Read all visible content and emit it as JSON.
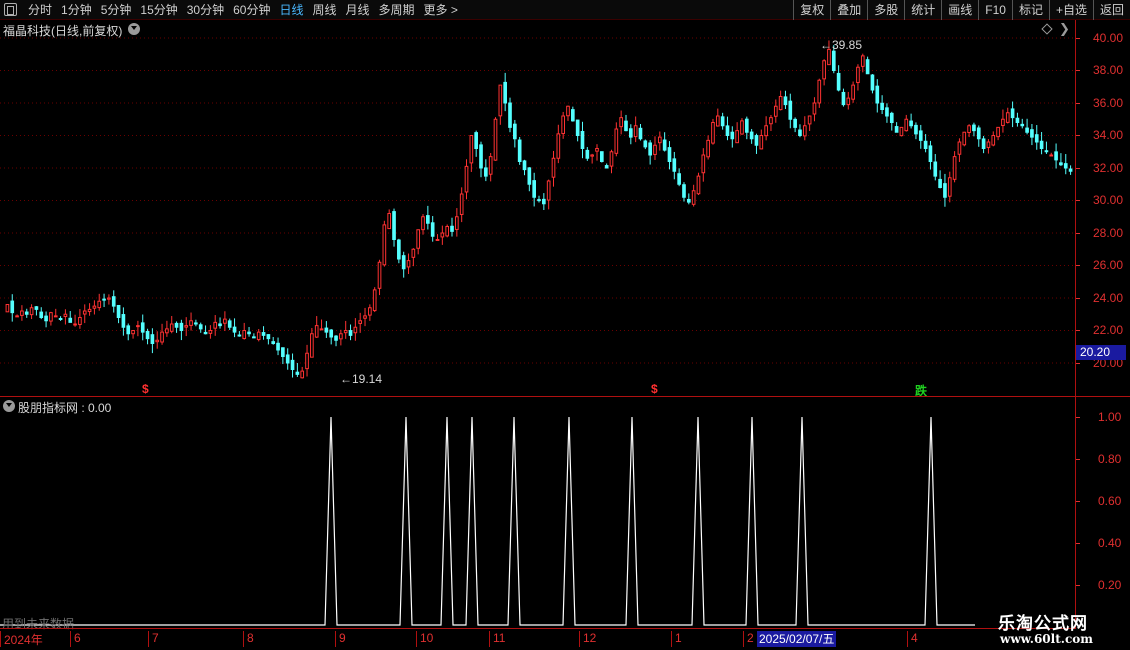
{
  "toolbar": {
    "period_tabs": [
      "分时",
      "1分钟",
      "5分钟",
      "15分钟",
      "30分钟",
      "60分钟",
      "日线",
      "周线",
      "月线",
      "多周期",
      "更多 >"
    ],
    "active_tab": "日线",
    "buttons": [
      "复权",
      "叠加",
      "多股",
      "统计",
      "画线",
      "F10",
      "标记",
      "+自选",
      "返回"
    ]
  },
  "price_pane": {
    "title": "福晶科技(日线,前复权)",
    "y_ticks": [
      "40.00",
      "38.00",
      "36.00",
      "34.00",
      "32.00",
      "30.00",
      "28.00",
      "26.00",
      "24.00",
      "22.00",
      "20.00"
    ],
    "last_price_label": "20.20",
    "high_label": "39.85",
    "low_label": "19.14",
    "signals": [
      {
        "text": "$",
        "kind": "buy"
      },
      {
        "text": "$",
        "kind": "buy"
      },
      {
        "text": "跌",
        "kind": "sell"
      }
    ]
  },
  "indicator_pane": {
    "title": "股朋指标网 : 0.00",
    "y_ticks": [
      "1.00",
      "0.80",
      "0.60",
      "0.40",
      "0.20"
    ],
    "note": "用到未来数据"
  },
  "date_axis": {
    "labels": [
      "2024年",
      "6",
      "7",
      "8",
      "9",
      "10",
      "11",
      "12",
      "1",
      "2",
      "4"
    ],
    "cursor_date": "2025/02/07/五"
  },
  "watermark": {
    "title": "乐淘公式网",
    "url": "www.60lt.com"
  },
  "chart_data": {
    "type": "candlestick",
    "title": "福晶科技(日线,前复权)",
    "price_ylim": [
      19,
      40.5
    ],
    "high": 39.85,
    "low": 19.14,
    "last": 20.2,
    "closes": [
      23.6,
      23.1,
      22.9,
      23.2,
      23.0,
      23.4,
      23.3,
      22.8,
      22.6,
      23.1,
      22.9,
      22.7,
      23.0,
      22.5,
      22.4,
      22.8,
      23.2,
      23.3,
      23.5,
      23.8,
      23.9,
      24.0,
      23.5,
      22.8,
      22.2,
      21.8,
      22.0,
      22.3,
      21.9,
      21.5,
      21.2,
      21.4,
      21.9,
      22.1,
      22.4,
      22.2,
      22.0,
      22.3,
      22.6,
      22.4,
      22.1,
      21.8,
      22.0,
      22.5,
      22.3,
      22.7,
      22.2,
      21.9,
      21.7,
      22.0,
      21.8,
      21.6,
      21.9,
      21.7,
      21.5,
      21.2,
      20.8,
      20.4,
      20.0,
      19.6,
      19.3,
      19.5,
      20.6,
      21.8,
      22.3,
      22.1,
      21.9,
      21.6,
      21.4,
      21.8,
      22.0,
      21.7,
      22.2,
      22.6,
      22.9,
      23.4,
      24.5,
      26.2,
      28.5,
      29.2,
      27.6,
      26.4,
      25.8,
      26.3,
      27.0,
      28.2,
      29.0,
      28.6,
      27.8,
      27.6,
      28.0,
      28.4,
      28.1,
      29.0,
      30.4,
      32.1,
      34.0,
      33.2,
      32.0,
      31.5,
      32.7,
      35.0,
      37.1,
      36.0,
      34.5,
      33.8,
      32.4,
      31.9,
      31.0,
      30.2,
      30.0,
      29.8,
      31.2,
      32.6,
      34.1,
      35.2,
      35.8,
      34.9,
      34.0,
      33.2,
      32.6,
      32.8,
      33.2,
      32.4,
      32.0,
      33.0,
      34.4,
      35.1,
      34.3,
      33.9,
      34.6,
      33.8,
      33.3,
      32.8,
      33.4,
      33.9,
      33.1,
      32.4,
      31.8,
      31.0,
      30.2,
      29.9,
      30.6,
      31.5,
      32.8,
      33.7,
      34.8,
      35.2,
      34.6,
      34.0,
      33.8,
      34.3,
      34.9,
      34.2,
      33.8,
      33.4,
      34.0,
      34.6,
      35.1,
      35.8,
      36.4,
      35.9,
      35.0,
      34.5,
      34.0,
      34.6,
      35.2,
      36.0,
      37.4,
      38.6,
      39.3,
      38.0,
      36.8,
      35.9,
      36.3,
      37.1,
      38.2,
      38.9,
      37.8,
      36.8,
      36.0,
      35.6,
      35.2,
      34.8,
      34.2,
      34.5,
      35.0,
      34.6,
      34.1,
      33.7,
      33.2,
      32.4,
      31.5,
      30.8,
      30.2,
      31.4,
      32.7,
      33.6,
      34.2,
      34.6,
      34.3,
      33.8,
      33.2,
      33.6,
      34.0,
      34.5,
      35.0,
      35.4,
      35.1,
      34.8,
      34.6,
      34.2,
      33.9,
      33.6,
      33.2,
      33.0,
      32.8,
      32.5,
      32.2,
      32.0,
      31.8
    ]
  }
}
